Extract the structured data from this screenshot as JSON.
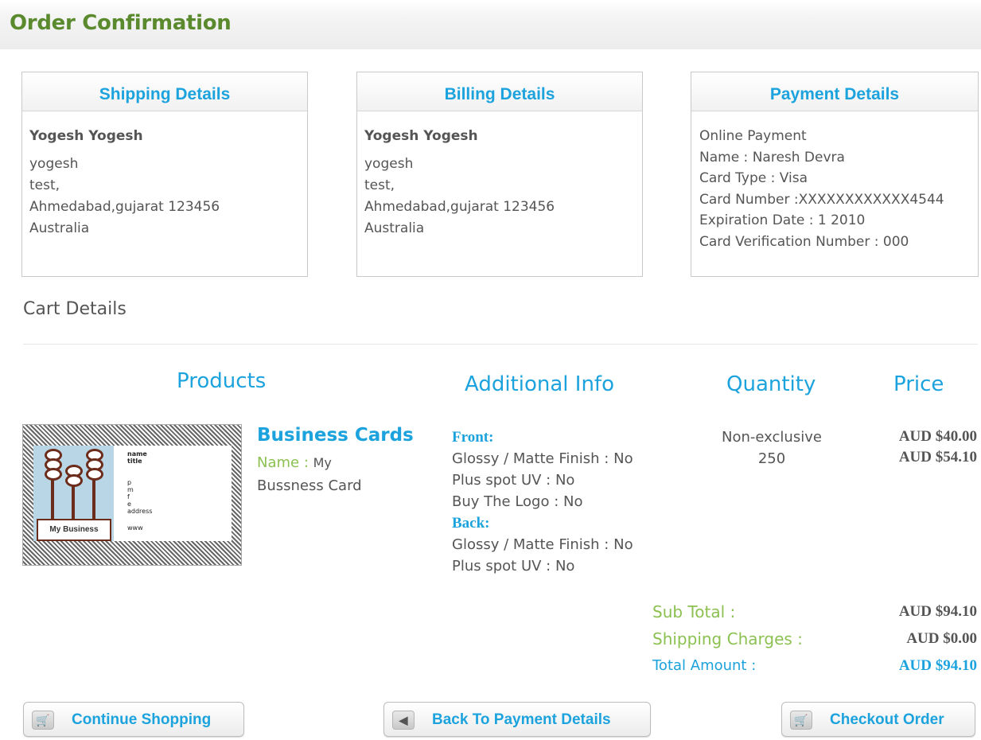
{
  "page": {
    "title": "Order Confirmation"
  },
  "shipping": {
    "heading": "Shipping Details",
    "name": "Yogesh Yogesh",
    "line1": "yogesh",
    "line2": "test,",
    "line3": "Ahmedabad,gujarat 123456",
    "line4": "Australia"
  },
  "billing": {
    "heading": "Billing Details",
    "name": "Yogesh Yogesh",
    "line1": "yogesh",
    "line2": "test,",
    "line3": "Ahmedabad,gujarat 123456",
    "line4": "Australia"
  },
  "payment": {
    "heading": "Payment Details",
    "method": "Online Payment",
    "name": "Name : Naresh Devra",
    "card_type": "Card Type : Visa",
    "card_number": "Card Number :XXXXXXXXXXXX4544",
    "expiration": "Expiration Date : 1 2010",
    "cvn": "Card Verification Number : 000"
  },
  "cart": {
    "title": "Cart Details",
    "columns": {
      "products": "Products",
      "info": "Additional Info",
      "quantity": "Quantity",
      "price": "Price"
    },
    "item": {
      "product_name": "Business Cards",
      "name_label": "Name : ",
      "name_value_1": "My",
      "name_value_2": "Bussness Card",
      "thumb_text": {
        "name": "name",
        "title": "title",
        "p": "p",
        "m": "m",
        "f": "f",
        "e": "e",
        "address": "address",
        "www": "www",
        "logo": "My Business"
      },
      "front_label": "Front:",
      "front_lines": [
        "Glossy / Matte Finish : No",
        "Plus spot UV : No",
        "Buy The Logo : No"
      ],
      "back_label": "Back:",
      "back_lines": [
        "Glossy / Matte Finish : No",
        "Plus spot UV : No"
      ],
      "quantity_type": "Non-exclusive",
      "quantity": "250",
      "price_1": "AUD $40.00",
      "price_2": "AUD $54.10"
    },
    "summary": {
      "subtotal_label": "Sub Total :",
      "subtotal": "AUD $94.10",
      "shipping_label": "Shipping Charges :",
      "shipping": "AUD $0.00",
      "total_label": "Total Amount :",
      "total": "AUD $94.10"
    }
  },
  "buttons": {
    "continue": "Continue Shopping",
    "back": "Back To Payment Details",
    "checkout": "Checkout Order"
  },
  "icons": {
    "continue": "cart-icon",
    "back": "back-arrow-icon",
    "checkout": "cart-icon"
  },
  "colors": {
    "accent": "#1ca3dd",
    "title_green": "#5b8a2e",
    "label_green": "#8cc152"
  }
}
